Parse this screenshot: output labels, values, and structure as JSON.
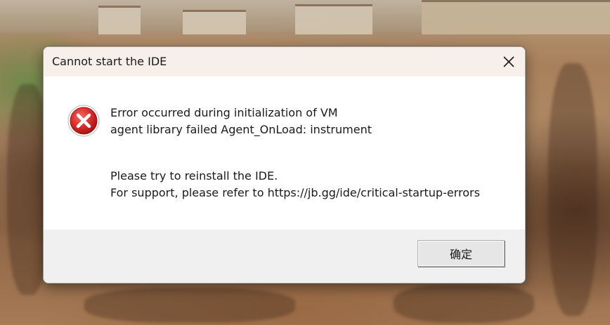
{
  "dialog": {
    "title": "Cannot start the IDE",
    "close_icon": "close-icon",
    "error_icon": "error-icon",
    "message_lines": [
      "Error occurred during initialization of VM",
      "agent library failed Agent_OnLoad: instrument"
    ],
    "support_lines": [
      "Please try to reinstall the IDE.",
      "For support, please refer to https://jb.gg/ide/critical-startup-errors"
    ],
    "ok_label": "确定"
  },
  "colors": {
    "titlebar": "#f6efea",
    "footer": "#f0f0f0",
    "error_red": "#d92b2b"
  }
}
